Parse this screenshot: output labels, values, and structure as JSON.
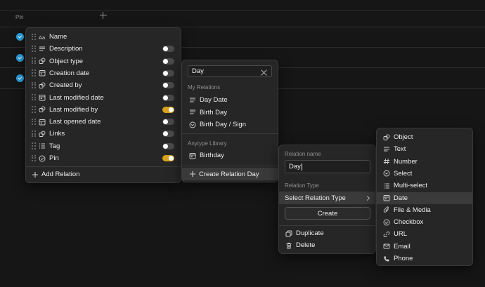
{
  "table": {
    "pin_header": "Pin"
  },
  "columns_menu": {
    "items": [
      {
        "label": "Name",
        "icon": "text-aa-icon",
        "toggle": null
      },
      {
        "label": "Description",
        "icon": "text-lines-icon",
        "toggle": false
      },
      {
        "label": "Object type",
        "icon": "object-icon",
        "toggle": false
      },
      {
        "label": "Creation date",
        "icon": "date-icon",
        "toggle": false
      },
      {
        "label": "Created by",
        "icon": "object-icon",
        "toggle": false
      },
      {
        "label": "Last modified date",
        "icon": "date-icon",
        "toggle": false
      },
      {
        "label": "Last modified by",
        "icon": "object-icon",
        "toggle": true
      },
      {
        "label": "Last opened date",
        "icon": "date-icon",
        "toggle": false
      },
      {
        "label": "Links",
        "icon": "object-icon",
        "toggle": false
      },
      {
        "label": "Tag",
        "icon": "multiselect-icon",
        "toggle": false
      },
      {
        "label": "Pin",
        "icon": "checkbox-icon",
        "toggle": true
      }
    ],
    "add_relation": "Add Relation"
  },
  "search_menu": {
    "query": "Day",
    "my_relations_header": "My Relations",
    "my_relations": [
      {
        "label": "Day Date",
        "icon": "text-lines-icon"
      },
      {
        "label": "Birth Day",
        "icon": "text-lines-icon"
      },
      {
        "label": "Birth Day / Sign",
        "icon": "select-icon"
      }
    ],
    "library_header": "Anytype Library",
    "library": [
      {
        "label": "Birthday",
        "icon": "date-icon"
      }
    ],
    "create_label": "Create Relation Day"
  },
  "relation_form": {
    "name_label": "Relation name",
    "name_value": "Day",
    "type_label": "Relation Type",
    "type_select": "Select Relation Type",
    "create_button": "Create",
    "duplicate": "Duplicate",
    "delete": "Delete"
  },
  "type_menu": {
    "items": [
      {
        "label": "Object",
        "icon": "object-icon"
      },
      {
        "label": "Text",
        "icon": "text-lines-icon"
      },
      {
        "label": "Number",
        "icon": "hash-icon"
      },
      {
        "label": "Select",
        "icon": "select-icon"
      },
      {
        "label": "Multi-select",
        "icon": "multiselect-icon"
      },
      {
        "label": "Date",
        "icon": "date-icon"
      },
      {
        "label": "File & Media",
        "icon": "paperclip-icon"
      },
      {
        "label": "Checkbox",
        "icon": "checkbox-icon"
      },
      {
        "label": "URL",
        "icon": "link-icon"
      },
      {
        "label": "Email",
        "icon": "email-icon"
      },
      {
        "label": "Phone",
        "icon": "phone-icon"
      }
    ],
    "selected": "Date"
  },
  "colors": {
    "background": "#161616",
    "panel": "#262626",
    "toggle_on": "#d9a21b",
    "check_blue": "#2aa1e0"
  }
}
